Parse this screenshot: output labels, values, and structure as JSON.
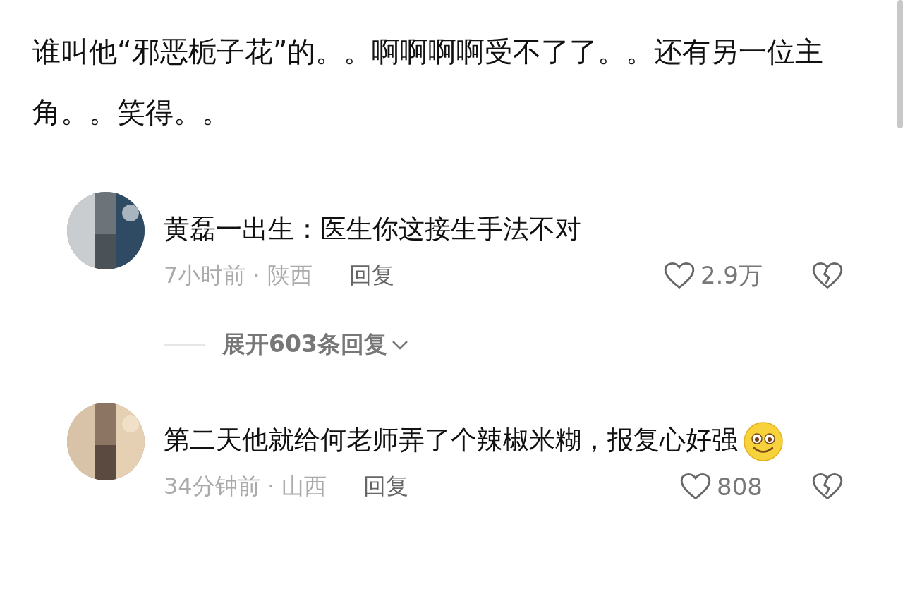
{
  "post": {
    "text": "谁叫他“邪恶栀子花”的。。啊啊啊啊受不了了。。还有另一位主角。。笑得。。"
  },
  "comments": [
    {
      "text": "黄磊一出生：医生你这接生手法不对",
      "emoji": false,
      "meta": "7小时前 · 陕西",
      "reply": "回复",
      "likes": "2.9万",
      "expand": "展开603条回复"
    },
    {
      "text": "第二天他就给何老师弄了个辣椒米糊，报复心好强",
      "emoji": true,
      "meta": "34分钟前 · 山西",
      "reply": "回复",
      "likes": "808"
    }
  ]
}
